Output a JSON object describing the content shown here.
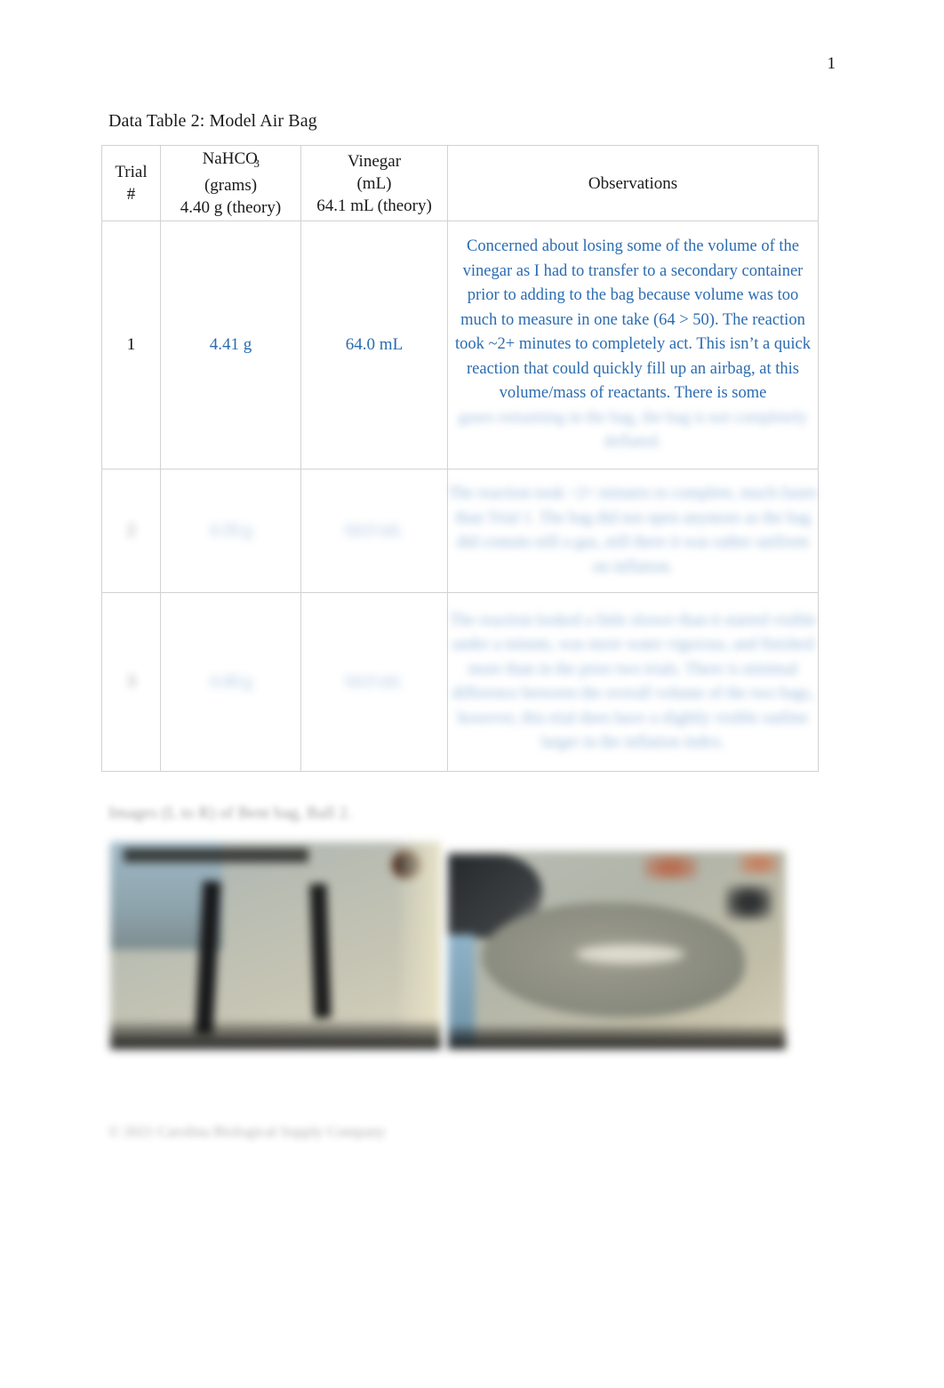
{
  "document": {
    "page_number": "1",
    "table_title": "Data Table 2: Model Air Bag"
  },
  "table": {
    "headers": {
      "trial": {
        "line1": "Trial",
        "line2": "#"
      },
      "nahco3": {
        "line1_prefix": "NaHCO",
        "line1_subscript": "3",
        "line2": "(grams)",
        "line3": "4.40 g (theory)"
      },
      "vinegar": {
        "line1": "Vinegar",
        "line2": "(mL)",
        "line3": "64.1 mL (theory)"
      },
      "observations": "Observations"
    },
    "rows": [
      {
        "trial": "1",
        "nahco3": "4.41 g",
        "vinegar": "64.0 mL",
        "observations": "Concerned about losing some of the volume of the vinegar as I had to transfer to a secondary container prior to adding to the bag because volume was too much to measure in one take (64 > 50). The reaction took ~2+ minutes to completely act. This isn’t a quick reaction that could quickly fill up an airbag, at this volume/mass of reactants. There is some",
        "observations_blurred_tail": "gases remaining in the bag, the bag is not completely deflated."
      },
      {
        "trial": "2",
        "nahco3": "4.39 g",
        "vinegar": "64.0 mL",
        "observations": "The reaction took ~2+ minutes to complete, much faster than Trial 1. The bag did not open anymore as the bag did contain still a gas, still there it was rather uniform on inflation."
      },
      {
        "trial": "3",
        "nahco3": "4.40 g",
        "vinegar": "64.0 mL",
        "observations": "The reaction looked a little slower than it started visible under a minute, was more water vigorous, and finished more than in the prior two trials. There is minimal difference between the overall volume of the two bags, however, this trial does have a slightly visible outline larger in the inflation index."
      }
    ]
  },
  "figure": {
    "caption": "Images (L to R) of Bent bag, Ball 2.",
    "photos": [
      {
        "alt": "photograph-of-inflated-model-air-bag-front-view"
      },
      {
        "alt": "photograph-of-inflated-model-air-bag-side-view"
      }
    ]
  },
  "footer": {
    "note": "© 2021 Carolina Biological Supply Company"
  },
  "colors": {
    "student_entry_text": "#2b6cb0",
    "body_text": "#1a1a1a",
    "table_border": "#d2d2d2"
  }
}
